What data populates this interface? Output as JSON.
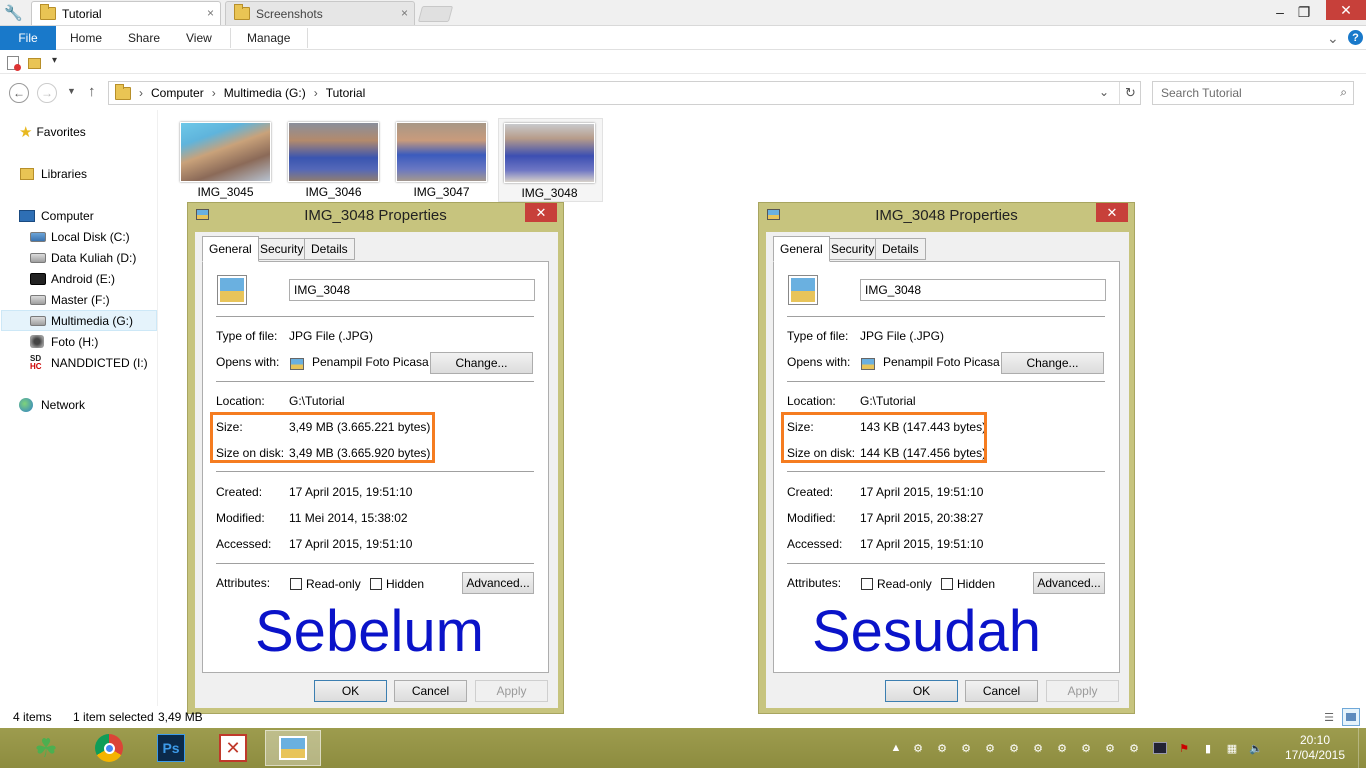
{
  "tabs": [
    {
      "label": "Tutorial",
      "close": "×"
    },
    {
      "label": "Screenshots",
      "close": "×"
    }
  ],
  "window_controls": {
    "minimize": "–",
    "maximize": "❐",
    "close": "✕"
  },
  "ribbon": {
    "file": "File",
    "tabs": [
      "Home",
      "Share",
      "View",
      "Manage"
    ],
    "expand": "⌄",
    "help": "?"
  },
  "address": {
    "crumbs": [
      "Computer",
      "Multimedia (G:)",
      "Tutorial"
    ],
    "separator": "›"
  },
  "search": {
    "placeholder": "Search Tutorial"
  },
  "nav": {
    "favorites": "Favorites",
    "libraries": "Libraries",
    "computer": "Computer",
    "drives": [
      "Local Disk (C:)",
      "Data Kuliah (D:)",
      "Android (E:)",
      "Master (F:)",
      "Multimedia (G:)",
      "Foto (H:)",
      "NANDDICTED (I:)"
    ],
    "network": "Network"
  },
  "files": [
    "IMG_3045",
    "IMG_3046",
    "IMG_3047",
    "IMG_3048"
  ],
  "dialog_common": {
    "title": "IMG_3048 Properties",
    "tabs": [
      "General",
      "Security",
      "Details"
    ],
    "name": "IMG_3048",
    "type_label": "Type of file:",
    "type_value": "JPG File (.JPG)",
    "opens_label": "Opens with:",
    "opens_value": "Penampil Foto Picasa",
    "change": "Change...",
    "location_label": "Location:",
    "location_value": "G:\\Tutorial",
    "size_label": "Size:",
    "disk_label": "Size on disk:",
    "created_label": "Created:",
    "modified_label": "Modified:",
    "accessed_label": "Accessed:",
    "attributes_label": "Attributes:",
    "readonly": "Read-only",
    "hidden": "Hidden",
    "advanced": "Advanced...",
    "ok": "OK",
    "cancel": "Cancel",
    "apply": "Apply"
  },
  "dialog_before": {
    "size": "3,49 MB (3.665.221 bytes)",
    "disk": "3,49 MB (3.665.920 bytes)",
    "created": "17 April 2015, 19:51:10",
    "modified": "11 Mei 2014, 15:38:02",
    "accessed": "17 April 2015, 19:51:10",
    "overlay": "Sebelum"
  },
  "dialog_after": {
    "size": "143 KB (147.443 bytes)",
    "disk": "144 KB (147.456 bytes)",
    "created": "17 April 2015, 19:51:10",
    "modified": "17 April 2015, 20:38:27",
    "accessed": "17 April 2015, 19:51:10",
    "overlay": "Sesudah"
  },
  "status": {
    "items": "4 items",
    "selected": "1 item selected",
    "size": "3,49 MB"
  },
  "clock": {
    "time": "20:10",
    "date": "17/04/2015"
  },
  "colors": {
    "accent": "#1979ca",
    "highlight": "#f57c20",
    "overlay_text": "#0a13c9",
    "taskbar": "#949347",
    "dialog_frame": "#c7c47e",
    "close_red": "#c7403a"
  }
}
